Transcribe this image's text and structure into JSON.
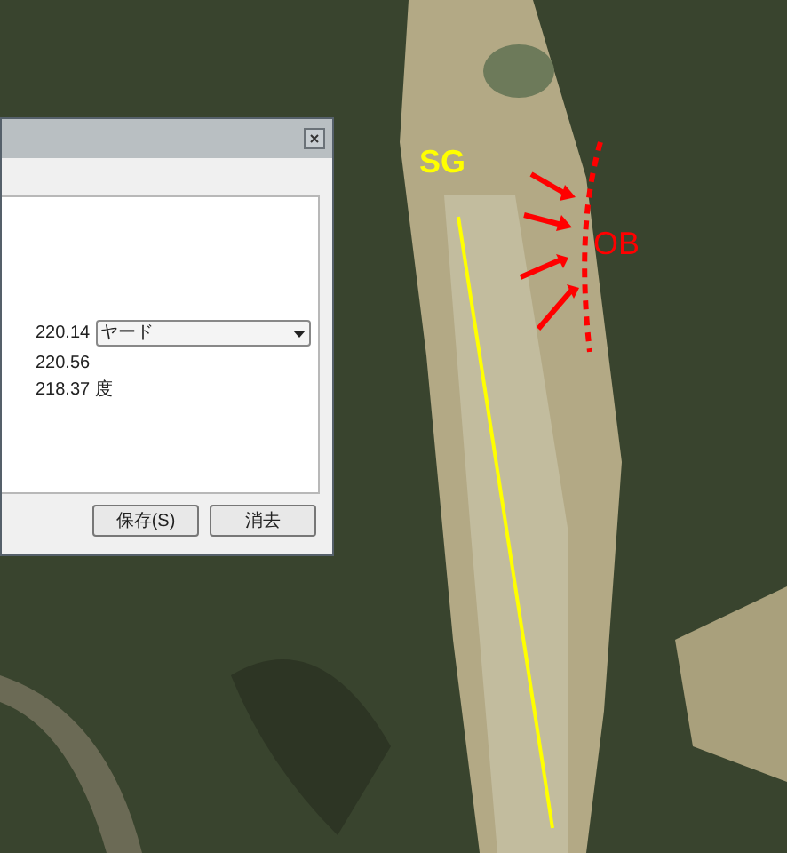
{
  "map": {
    "labels": [
      {
        "text": "SG",
        "color": "#ffff00"
      },
      {
        "text": "OB",
        "color": "#ff0000"
      }
    ]
  },
  "ruler_dialog": {
    "length": "220.14",
    "unit": "ヤード",
    "ground_length": "220.56",
    "heading": "218.37 度",
    "buttons": [
      "保存(S)",
      "消去"
    ]
  }
}
